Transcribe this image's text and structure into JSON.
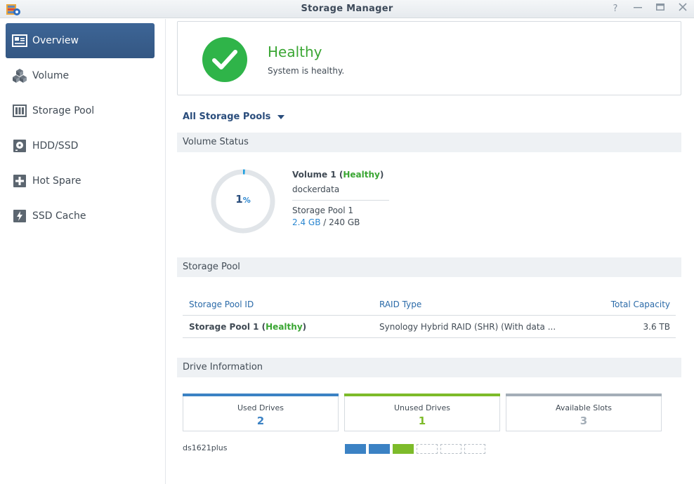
{
  "window": {
    "title": "Storage Manager",
    "buttons": {
      "help": "?",
      "minimize": "—",
      "maximize": "□",
      "close": "✕"
    }
  },
  "sidebar": {
    "items": [
      {
        "label": "Overview",
        "icon": "overview-icon",
        "active": true
      },
      {
        "label": "Volume",
        "icon": "volume-icon",
        "active": false
      },
      {
        "label": "Storage Pool",
        "icon": "storage-pool-icon",
        "active": false
      },
      {
        "label": "HDD/SSD",
        "icon": "hdd-icon",
        "active": false
      },
      {
        "label": "Hot Spare",
        "icon": "hot-spare-icon",
        "active": false
      },
      {
        "label": "SSD Cache",
        "icon": "ssd-cache-icon",
        "active": false
      }
    ]
  },
  "health": {
    "status": "Healthy",
    "message": "System is healthy.",
    "color": "#2fb449"
  },
  "pool_selector": {
    "label": "All Storage Pools"
  },
  "volume_status": {
    "heading": "Volume Status",
    "usage_percent": 1,
    "usage_number": "1",
    "usage_unit": "%",
    "volume_name": "Volume 1",
    "volume_state": "Healthy",
    "description": "dockerdata",
    "pool": "Storage Pool 1",
    "used": "2.4 GB",
    "separator": " / ",
    "total": "240 GB"
  },
  "storage_pool": {
    "heading": "Storage Pool",
    "columns": [
      "Storage Pool ID",
      "RAID Type",
      "Total Capacity"
    ],
    "rows": [
      {
        "id": "Storage Pool 1",
        "state": "Healthy",
        "raid": "Synology Hybrid RAID (SHR) (With data ...",
        "capacity": "3.6 TB"
      }
    ]
  },
  "drive_info": {
    "heading": "Drive Information",
    "cards": [
      {
        "label": "Used Drives",
        "value": "2",
        "color": "#3b82c4"
      },
      {
        "label": "Unused Drives",
        "value": "1",
        "color": "#7dbb2a"
      },
      {
        "label": "Available Slots",
        "value": "3",
        "color": "#a4aeb8"
      }
    ],
    "device": "ds1621plus",
    "slots": [
      "used",
      "used",
      "unused",
      "empty",
      "empty",
      "empty"
    ]
  },
  "colors": {
    "accent": "#3a5f8f",
    "healthy": "#3aa633",
    "link": "#2a86d0",
    "used": "#3b82c4",
    "unused": "#7dbb2a",
    "available": "#a4aeb8"
  }
}
